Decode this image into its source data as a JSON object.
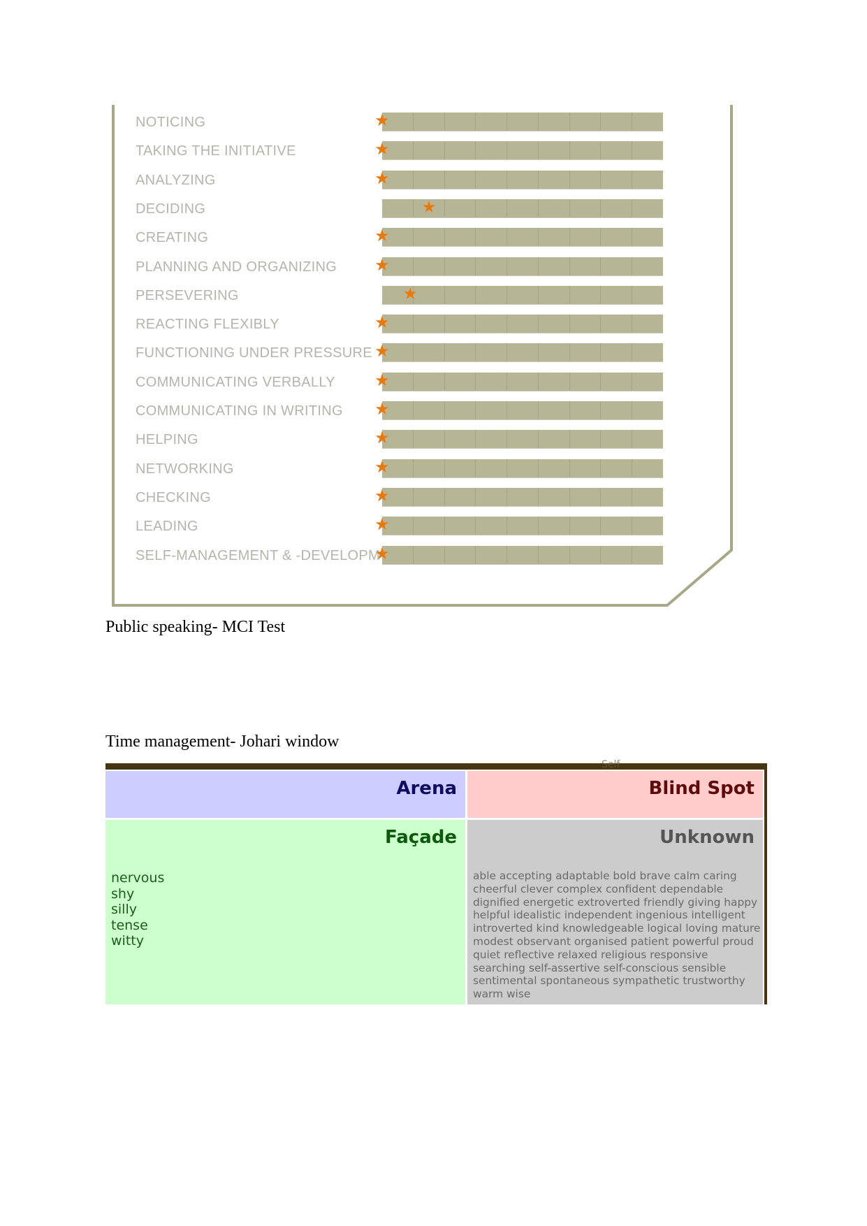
{
  "mci_chart": {
    "scale_segments": 9,
    "colors": {
      "bar": "#b6b595",
      "label": "#b5b5ad",
      "star": "#e47a12",
      "frame": "#a7a887"
    },
    "star_icon": "star-icon",
    "competencies": [
      {
        "label": "NOTICING",
        "score": 0
      },
      {
        "label": "TAKING THE INITIATIVE",
        "score": 0
      },
      {
        "label": "ANALYZING",
        "score": 0
      },
      {
        "label": "DECIDING",
        "score": 1.5
      },
      {
        "label": "CREATING",
        "score": 0
      },
      {
        "label": "PLANNING AND ORGANIZING",
        "score": 0
      },
      {
        "label": "PERSEVERING",
        "score": 0.9
      },
      {
        "label": "REACTING FLEXIBLY",
        "score": 0
      },
      {
        "label": "FUNCTIONING UNDER PRESSURE",
        "score": 0
      },
      {
        "label": "COMMUNICATING VERBALLY",
        "score": 0
      },
      {
        "label": "COMMUNICATING IN WRITING",
        "score": 0
      },
      {
        "label": "HELPING",
        "score": 0
      },
      {
        "label": "NETWORKING",
        "score": 0
      },
      {
        "label": "CHECKING",
        "score": 0
      },
      {
        "label": "LEADING",
        "score": 0
      },
      {
        "label": "SELF-MANAGEMENT & -DEVELOPM",
        "score": 0
      }
    ]
  },
  "captions": {
    "mci": "Public speaking- MCI Test",
    "johari": "Time management- Johari window"
  },
  "johari": {
    "top_label": "Self",
    "colors": {
      "frame": "#473511",
      "arena": "#ccccfe",
      "blind_spot": "#ffcccc",
      "facade": "#ccffcc",
      "unknown": "#cccccc"
    },
    "arena": {
      "title": "Arena",
      "words": []
    },
    "blind_spot": {
      "title": "Blind Spot",
      "words": []
    },
    "facade": {
      "title": "Façade",
      "words": [
        "nervous",
        "shy",
        "silly",
        "tense",
        "witty"
      ]
    },
    "unknown": {
      "title": "Unknown",
      "text": "able accepting adaptable bold brave calm caring cheerful clever complex confident dependable dignified energetic extroverted friendly giving happy helpful idealistic independent ingenious intelligent introverted kind knowledgeable logical loving mature modest observant organised patient powerful proud quiet reflective relaxed religious responsive searching self-assertive self-conscious sensible sentimental spontaneous sympathetic trustworthy warm wise"
    }
  }
}
